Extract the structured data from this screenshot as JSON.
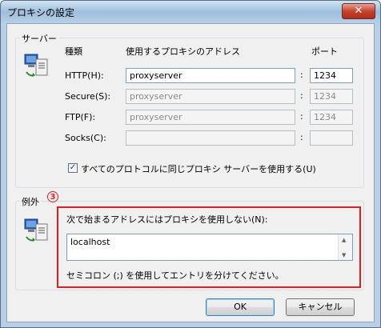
{
  "window": {
    "title": "プロキシの設定",
    "close_glyph": "✕"
  },
  "servers": {
    "group_label": "サーバー",
    "col_type": "種類",
    "col_address": "使用するプロキシのアドレス",
    "col_port": "ポート",
    "rows": [
      {
        "label": "HTTP(H):",
        "address": "proxyserver",
        "port": "1234",
        "enabled": true
      },
      {
        "label": "Secure(S):",
        "address": "proxyserver",
        "port": "1234",
        "enabled": false
      },
      {
        "label": "FTP(F):",
        "address": "proxyserver",
        "port": "1234",
        "enabled": false
      },
      {
        "label": "Socks(C):",
        "address": "",
        "port": "",
        "enabled": false
      }
    ],
    "separator": ":",
    "same_proxy_checkbox": {
      "label": "すべてのプロトコルに同じプロキシ サーバーを使用する(U)",
      "checked": true
    }
  },
  "exceptions": {
    "group_label": "例外",
    "annotation_number": "3",
    "description": "次で始まるアドレスにはプロキシを使用しない(N):",
    "value": "localhost",
    "hint": "セミコロン (;) を使用してエントリを分けてください。"
  },
  "buttons": {
    "ok": "OK",
    "cancel": "キャンセル"
  },
  "colors": {
    "annotation": "#e02020",
    "title_gradient_top": "#cfe2f3",
    "close_button": "#c5442f"
  }
}
